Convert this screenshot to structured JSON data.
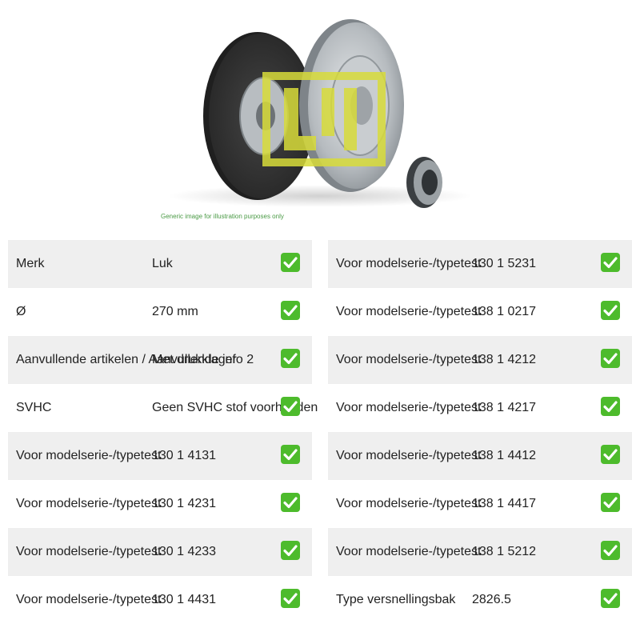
{
  "image": {
    "caption": "Generic image for illustration purposes only",
    "logo_text": "LuK"
  },
  "check_icon": "check-mark-icon",
  "accent_color": "#4dbb2c",
  "left_rows": [
    {
      "label": "Merk",
      "value": "Luk"
    },
    {
      "label": "Ø",
      "value": "270 mm"
    },
    {
      "label": "Aanvullende artikelen / Aanvullende info 2",
      "value": "Met drukklager"
    },
    {
      "label": "SVHC",
      "value": "Geen SVHC stof voorhanden"
    },
    {
      "label": "Voor modelserie-/typetest",
      "value": "130 1 4131"
    },
    {
      "label": "Voor modelserie-/typetest",
      "value": "130 1 4231"
    },
    {
      "label": "Voor modelserie-/typetest",
      "value": "130 1 4233"
    },
    {
      "label": "Voor modelserie-/typetest",
      "value": "130 1 4431"
    }
  ],
  "right_rows": [
    {
      "label": "Voor modelserie-/typetest",
      "value": "130 1 5231"
    },
    {
      "label": "Voor modelserie-/typetest",
      "value": "138 1 0217"
    },
    {
      "label": "Voor modelserie-/typetest",
      "value": "138 1 4212"
    },
    {
      "label": "Voor modelserie-/typetest",
      "value": "138 1 4217"
    },
    {
      "label": "Voor modelserie-/typetest",
      "value": "138 1 4412"
    },
    {
      "label": "Voor modelserie-/typetest",
      "value": "138 1 4417"
    },
    {
      "label": "Voor modelserie-/typetest",
      "value": "138 1 5212"
    },
    {
      "label": "Type versnellingsbak",
      "value": "2826.5"
    }
  ]
}
